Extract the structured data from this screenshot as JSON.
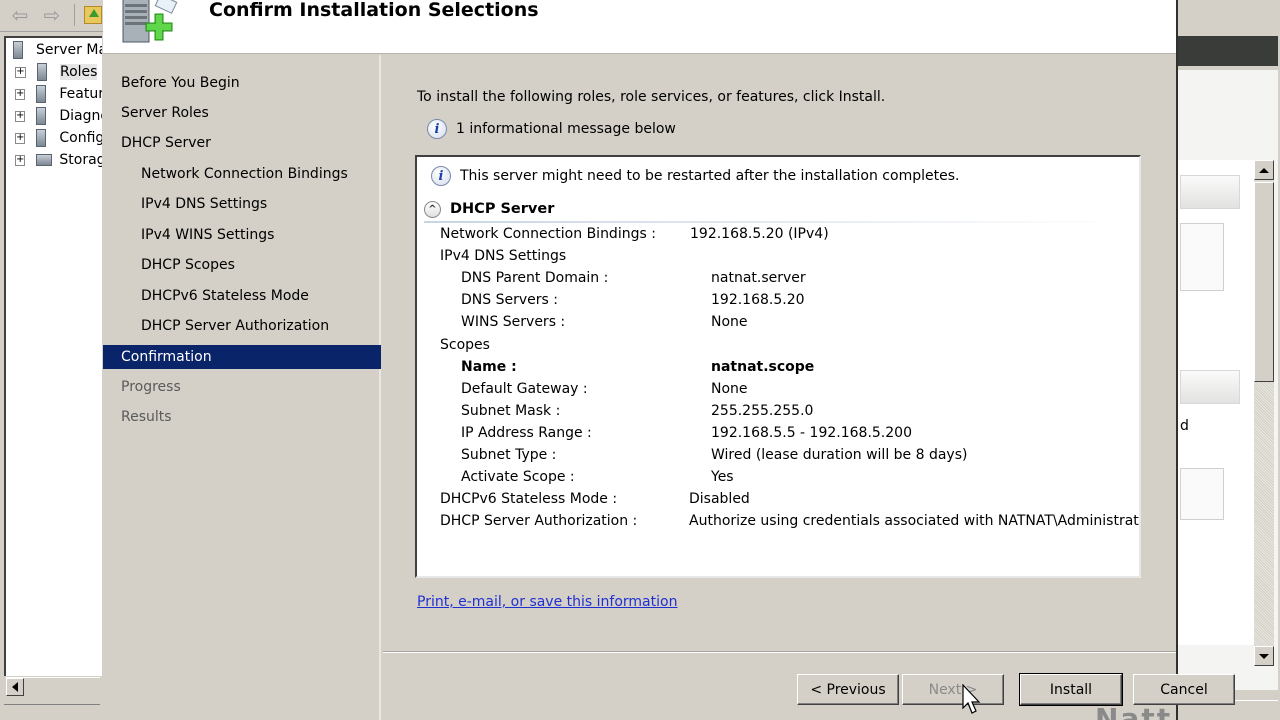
{
  "server_manager": {
    "tree": [
      {
        "label": "Server Manager",
        "expandable": false,
        "icon": "server-manager-icon"
      },
      {
        "label": "Roles",
        "expandable": true,
        "icon": "roles-icon",
        "selected": true
      },
      {
        "label": "Features",
        "expandable": true,
        "icon": "features-icon"
      },
      {
        "label": "Diagnostics",
        "expandable": true,
        "icon": "diagnostics-icon"
      },
      {
        "label": "Configuration",
        "expandable": true,
        "icon": "configuration-icon"
      },
      {
        "label": "Storage",
        "expandable": true,
        "icon": "storage-icon"
      }
    ],
    "expander_glyph": "+",
    "right_pane_fragment": "d",
    "watermark": "Natt"
  },
  "wizard": {
    "title": "Confirm Installation Selections",
    "steps": [
      {
        "label": "Before You Begin",
        "level": "top",
        "state": "done"
      },
      {
        "label": "Server Roles",
        "level": "top",
        "state": "done"
      },
      {
        "label": "DHCP Server",
        "level": "top",
        "state": "done"
      },
      {
        "label": "Network Connection Bindings",
        "level": "sub",
        "state": "done"
      },
      {
        "label": "IPv4 DNS Settings",
        "level": "sub",
        "state": "done"
      },
      {
        "label": "IPv4 WINS Settings",
        "level": "sub",
        "state": "done"
      },
      {
        "label": "DHCP Scopes",
        "level": "sub",
        "state": "done"
      },
      {
        "label": "DHCPv6 Stateless Mode",
        "level": "sub",
        "state": "done"
      },
      {
        "label": "DHCP Server Authorization",
        "level": "sub",
        "state": "done"
      },
      {
        "label": "Confirmation",
        "level": "top",
        "state": "current"
      },
      {
        "label": "Progress",
        "level": "top",
        "state": "pending"
      },
      {
        "label": "Results",
        "level": "top",
        "state": "pending"
      }
    ],
    "intro": "To install the following roles, role services, or features, click Install.",
    "info_count_message": "1 informational message below",
    "info_glyph": "i",
    "summary": {
      "message": "This server might need to be restarted after the installation completes.",
      "section_title": "DHCP Server",
      "collapse_glyph": "^",
      "rows": [
        {
          "label": "Network Connection Bindings :",
          "value": "192.168.5.20 (IPv4)",
          "indent": 0
        },
        {
          "label": "IPv4 DNS Settings",
          "value": "",
          "indent": 0
        },
        {
          "label": "DNS Parent Domain :",
          "value": "natnat.server",
          "indent": 1
        },
        {
          "label": "DNS Servers :",
          "value": "192.168.5.20",
          "indent": 1
        },
        {
          "label": "WINS Servers :",
          "value": "None",
          "indent": 1
        },
        {
          "label": "Scopes",
          "value": "",
          "indent": 0
        },
        {
          "label": "Name :",
          "value": "natnat.scope",
          "indent": 1,
          "bold": true
        },
        {
          "label": "Default Gateway :",
          "value": "None",
          "indent": 1
        },
        {
          "label": "Subnet Mask :",
          "value": "255.255.255.0",
          "indent": 1
        },
        {
          "label": "IP Address Range :",
          "value": "192.168.5.5 - 192.168.5.200",
          "indent": 1
        },
        {
          "label": "Subnet Type :",
          "value": "Wired (lease duration will be 8 days)",
          "indent": 1
        },
        {
          "label": "Activate Scope :",
          "value": "Yes",
          "indent": 1
        },
        {
          "label": "DHCPv6 Stateless Mode :",
          "value": "Disabled",
          "indent": 0
        },
        {
          "label": "DHCP Server Authorization :",
          "value": "Authorize using credentials associated with NATNAT\\Administrator",
          "indent": 0
        }
      ]
    },
    "print_link": "Print, e-mail, or save this information",
    "buttons": {
      "previous": "< Previous",
      "next": "Next >",
      "install": "Install",
      "cancel": "Cancel"
    }
  }
}
